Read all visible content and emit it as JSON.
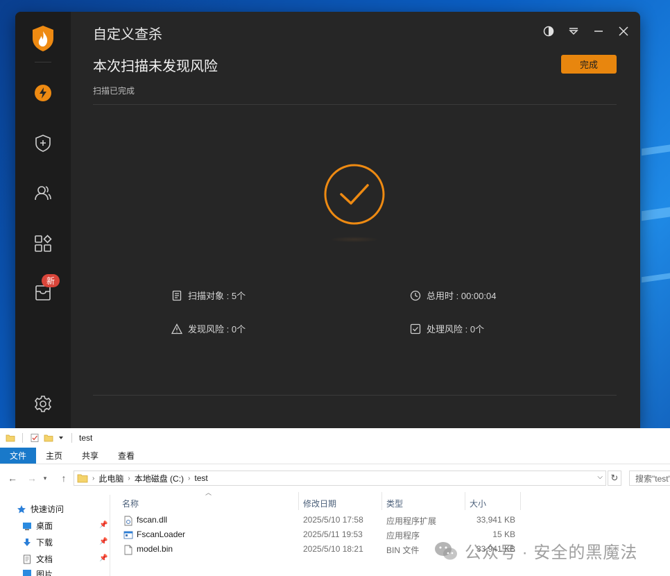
{
  "app": {
    "title": "自定义查杀",
    "headline": "本次扫描未发现风险",
    "status": "扫描已完成",
    "done_button": "完成",
    "accent": "#E8860E",
    "badge_new": "新",
    "stats": {
      "scan_objects": "扫描对象 : 5个",
      "total_time": "总用时 : 00:00:04",
      "risks_found": "发现风险 : 0个",
      "risks_handled": "处理风险 : 0个"
    },
    "sidebar_icons": [
      "shield-flame-logo-icon",
      "lightning-icon",
      "shield-plus-icon",
      "users-icon",
      "apps-icon",
      "box-icon",
      "gear-icon"
    ],
    "window_icons": [
      "theme-icon",
      "menu-icon",
      "minimize-icon",
      "close-icon"
    ]
  },
  "explorer": {
    "title": "test",
    "ribbon_tabs": [
      "文件",
      "主页",
      "共享",
      "查看"
    ],
    "breadcrumb": [
      "此电脑",
      "本地磁盘 (C:)",
      "test"
    ],
    "search_placeholder": "搜索\"test\"",
    "nav": [
      "快速访问",
      "桌面",
      "下载",
      "文档",
      "图片"
    ],
    "columns": {
      "name": "名称",
      "modified": "修改日期",
      "type": "类型",
      "size": "大小"
    },
    "files": [
      {
        "name": "fscan.dll",
        "modified": "2025/5/10 17:58",
        "type": "应用程序扩展",
        "size": "33,941 KB",
        "icon": "dll-icon"
      },
      {
        "name": "FscanLoader",
        "modified": "2025/5/11 19:53",
        "type": "应用程序",
        "size": "15 KB",
        "icon": "exe-icon"
      },
      {
        "name": "model.bin",
        "modified": "2025/5/10 18:21",
        "type": "BIN 文件",
        "size": "33,941 KB",
        "icon": "file-icon"
      }
    ]
  },
  "watermark": "公众号 · 安全的黑魔法"
}
